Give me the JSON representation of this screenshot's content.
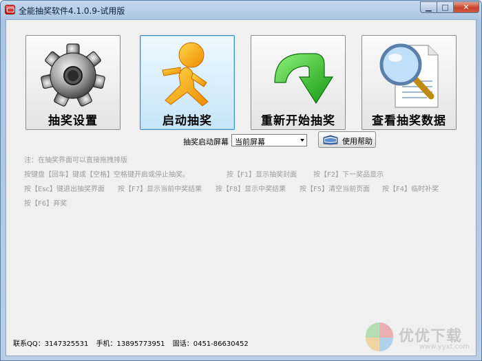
{
  "window": {
    "title": "全能抽奖软件4.1.0.9-试用版",
    "minimize_glyph": "▁",
    "maximize_glyph": "□",
    "close_glyph": "✕"
  },
  "toolbar": {
    "buttons": [
      {
        "label": "抽奖设置",
        "icon": "gear-icon",
        "selected": false
      },
      {
        "label": "启动抽奖",
        "icon": "running-man-icon",
        "selected": true
      },
      {
        "label": "重新开始抽奖",
        "icon": "green-arrow-icon",
        "selected": false
      },
      {
        "label": "查看抽奖数据",
        "icon": "magnifier-document-icon",
        "selected": false
      }
    ]
  },
  "screen_select": {
    "label": "抽奖启动屏幕",
    "value": "当前屏幕"
  },
  "help_button": {
    "label": "使用帮助",
    "icon": "book-icon"
  },
  "hints": {
    "note": "注：在抽奖界面可以直接拖拽排版",
    "line1a": "按键盘【回车】键或【空格】空格键开启或停止抽奖。",
    "line1b": "按【F1】显示抽奖封面",
    "line1c": "按【F2】下一奖品显示",
    "line2a": "按【Esc】键退出抽奖界面",
    "line2b": "按【F7】显示当前中奖结果",
    "line2c": "按【F8】显示中奖结果",
    "line2d": "按【F5】清空当前页面",
    "line2e": "按【F4】临时补奖",
    "line3a": "按【F6】弃奖"
  },
  "footer": {
    "qq": "联系QQ：3147325531",
    "phone": "手机：13895773951",
    "tel": "固话：0451-86630452"
  },
  "watermark": {
    "text": "优优下载",
    "url": "www.yyxt.com"
  }
}
